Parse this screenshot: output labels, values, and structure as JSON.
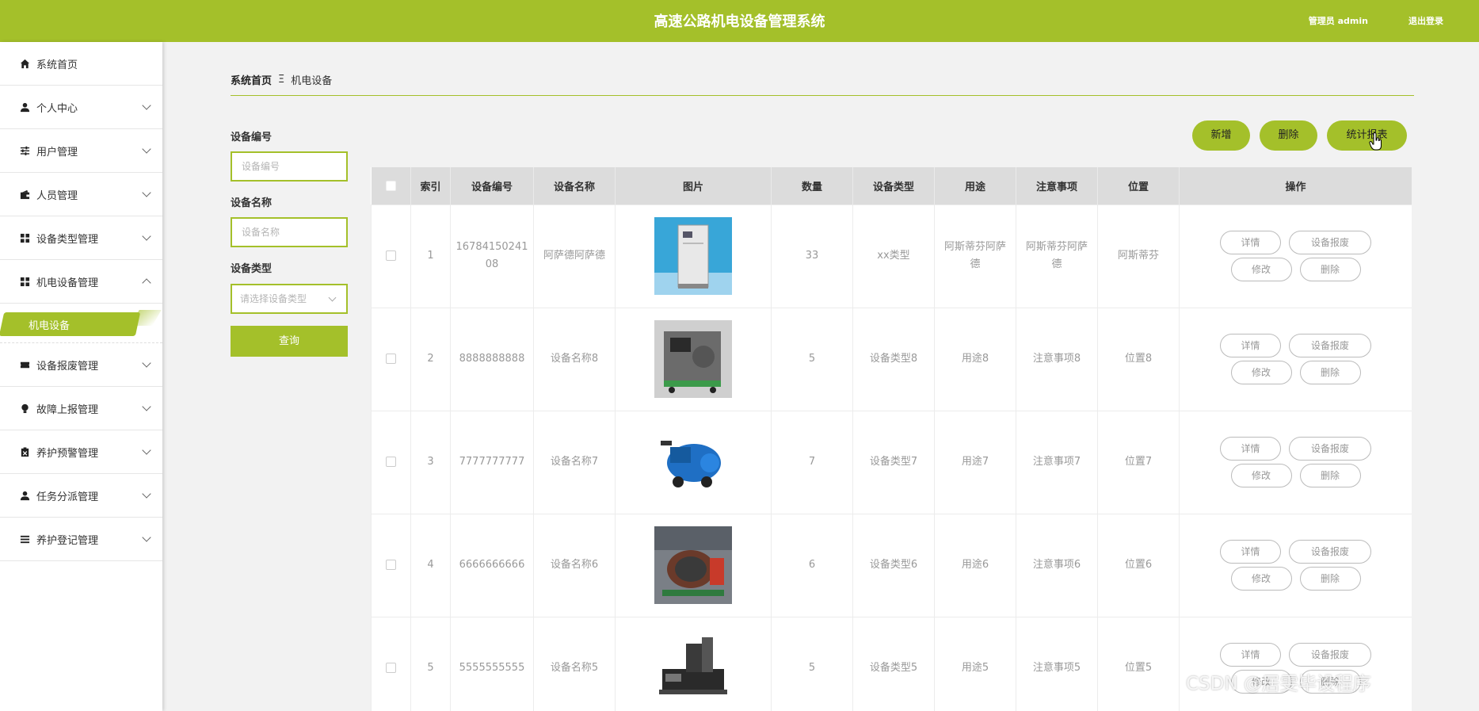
{
  "header": {
    "title": "高速公路机电设备管理系统",
    "user": "管理员 admin",
    "logout": "退出登录"
  },
  "sidebar": {
    "items": [
      {
        "label": "系统首页",
        "icon": "home-icon"
      },
      {
        "label": "个人中心",
        "icon": "person-icon"
      },
      {
        "label": "用户管理",
        "icon": "sliders-icon"
      },
      {
        "label": "人员管理",
        "icon": "wallet-icon"
      },
      {
        "label": "设备类型管理",
        "icon": "grid-icon"
      },
      {
        "label": "机电设备管理",
        "icon": "grid-icon"
      },
      {
        "label": "设备报废管理",
        "icon": "ticket-icon"
      },
      {
        "label": "故障上报管理",
        "icon": "bulb-icon"
      },
      {
        "label": "养护预警管理",
        "icon": "clipboard-icon"
      },
      {
        "label": "任务分派管理",
        "icon": "person-icon"
      },
      {
        "label": "养护登记管理",
        "icon": "list-icon"
      }
    ],
    "active_sub": "机电设备"
  },
  "breadcrumb": {
    "home": "系统首页",
    "current": "机电设备"
  },
  "search": {
    "code_label": "设备编号",
    "code_placeholder": "设备编号",
    "name_label": "设备名称",
    "name_placeholder": "设备名称",
    "type_label": "设备类型",
    "type_placeholder": "请选择设备类型",
    "query_button": "查询"
  },
  "actions": {
    "add": "新增",
    "delete": "删除",
    "report": "统计报表"
  },
  "table": {
    "columns": [
      "索引",
      "设备编号",
      "设备名称",
      "图片",
      "数量",
      "设备类型",
      "用途",
      "注意事项",
      "位置",
      "操作"
    ],
    "rows": [
      {
        "index": "1",
        "code": "1678415024108",
        "name": "阿萨德阿萨德",
        "image": "cabinet-machine",
        "qty": "33",
        "type": "xx类型",
        "use": "阿斯蒂芬阿萨德",
        "note": "阿斯蒂芬阿萨德",
        "location": "阿斯蒂芬"
      },
      {
        "index": "2",
        "code": "8888888888",
        "name": "设备名称8",
        "image": "industrial-box",
        "qty": "5",
        "type": "设备类型8",
        "use": "用途8",
        "note": "注意事项8",
        "location": "位置8"
      },
      {
        "index": "3",
        "code": "7777777777",
        "name": "设备名称7",
        "image": "blue-machine",
        "qty": "7",
        "type": "设备类型7",
        "use": "用途7",
        "note": "注意事项7",
        "location": "位置7"
      },
      {
        "index": "4",
        "code": "6666666666",
        "name": "设备名称6",
        "image": "drum-machine",
        "qty": "6",
        "type": "设备类型6",
        "use": "用途6",
        "note": "注意事项6",
        "location": "位置6"
      },
      {
        "index": "5",
        "code": "5555555555",
        "name": "设备名称5",
        "image": "cnc-machine",
        "qty": "5",
        "type": "设备类型5",
        "use": "用途5",
        "note": "注意事项5",
        "location": "位置5"
      }
    ],
    "op_labels": {
      "detail": "详情",
      "scrap": "设备报废",
      "edit": "修改",
      "delete": "删除"
    }
  },
  "watermark": "CSDN @居雯毕设程序",
  "colors": {
    "accent": "#a4c02a",
    "header_bg": "#dcdcdc"
  }
}
